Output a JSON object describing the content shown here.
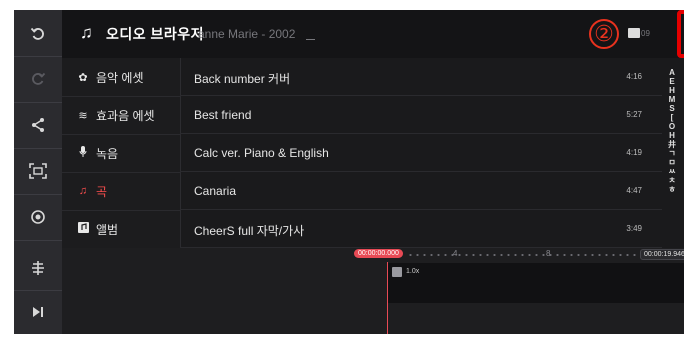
{
  "topbar": {
    "title": "오디오 브라우저",
    "ghost_text": "anne Marie - 2002",
    "step_marker": "②",
    "folder_label": "09"
  },
  "rail": [
    "undo-icon",
    "redo-icon",
    "share-icon",
    "capture-icon",
    "record-icon",
    "split-icon",
    "skip-to-end-icon"
  ],
  "categories": [
    {
      "label": "음악 에셋",
      "icon": "music-asset-icon"
    },
    {
      "label": "효과음 에셋",
      "icon": "sound-effect-icon"
    },
    {
      "label": "녹음",
      "icon": "microphone-icon"
    },
    {
      "label": "곡",
      "icon": "song-note-icon",
      "active": true
    },
    {
      "label": "앨범",
      "icon": "album-icon"
    }
  ],
  "songs": [
    {
      "title": "Back number 커버",
      "duration": "4:16"
    },
    {
      "title": "Best friend",
      "duration": "5:27"
    },
    {
      "title": "Calc ver. Piano & English",
      "duration": "4:19"
    },
    {
      "title": "Canaria",
      "duration": "4:47"
    },
    {
      "title": "CheerS full 자막/가사",
      "duration": "3:49"
    }
  ],
  "alpha_index": [
    "A",
    "E",
    "H",
    "M",
    "S",
    "[",
    "O",
    "H",
    "井",
    "ㄱ",
    "ㅁ",
    "ㅆ",
    "ㅊ",
    "ㅎ"
  ],
  "timeline": {
    "playhead_time": "00:00:00.000",
    "end_time": "00:00:19.946",
    "tick_4": "4",
    "tick_8": "8",
    "clip_speed": "1.0x"
  },
  "colors": {
    "accent": "#e84a55",
    "highlight": "#e60000",
    "step_marker": "#e8321e"
  }
}
